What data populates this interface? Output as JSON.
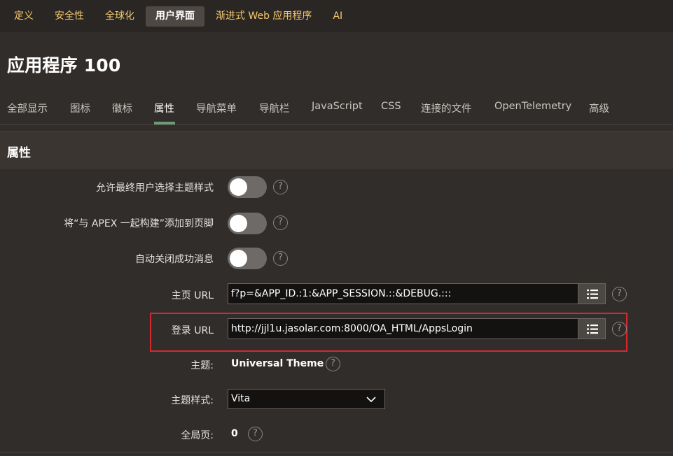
{
  "topnav": {
    "tabs": [
      "定义",
      "安全性",
      "全球化",
      "用户界面",
      "渐进式 Web 应用程序",
      "AI"
    ],
    "active_index": 3
  },
  "page": {
    "title": "应用程序 100"
  },
  "subtabs": {
    "items": [
      "全部显示",
      "图标",
      "徽标",
      "属性",
      "导航菜单",
      "导航栏",
      "JavaScript",
      "CSS",
      "连接的文件",
      "OpenTelemetry",
      "高级"
    ],
    "active_index": 3
  },
  "region": {
    "title": "属性"
  },
  "fields": {
    "allow_theme_style": {
      "label": "允许最终用户选择主题样式",
      "value": "off"
    },
    "built_with_apex": {
      "label": "将“与 APEX 一起构建”添加到页脚",
      "value": "off"
    },
    "auto_dismiss": {
      "label": "自动关闭成功消息",
      "value": "off"
    },
    "home_url": {
      "label": "主页 URL",
      "value": "f?p=&APP_ID.:1:&APP_SESSION.::&DEBUG.:::"
    },
    "login_url": {
      "label": "登录 URL",
      "value": "http://jjl1u.jasolar.com:8000/OA_HTML/AppsLogin"
    },
    "theme": {
      "label": "主题:",
      "value": "Universal Theme"
    },
    "theme_style": {
      "label": "主题样式:",
      "value": "Vita"
    },
    "global_page": {
      "label": "全局页:",
      "value": "0"
    }
  },
  "help_symbol": "?",
  "colors": {
    "accent_text": "#f4c96e",
    "active_underline": "#6d9b74",
    "highlight_border": "#d7282f",
    "background": "#312d2a"
  }
}
